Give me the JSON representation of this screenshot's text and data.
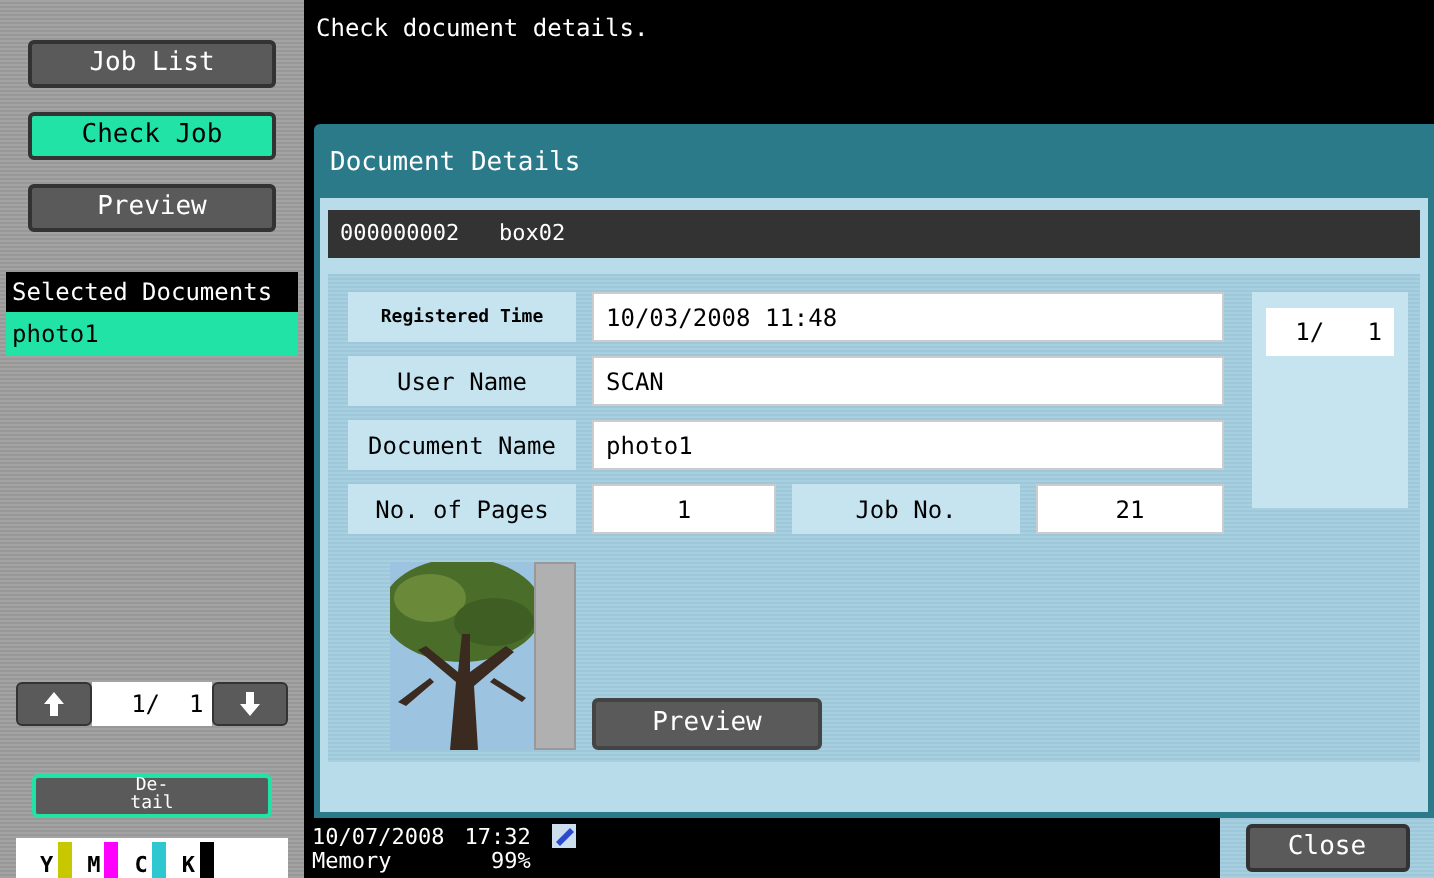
{
  "nav_buttons": [
    {
      "label": "Job List",
      "selected": false
    },
    {
      "label": "Check Job",
      "selected": true
    },
    {
      "label": "Preview",
      "selected": false
    }
  ],
  "selected_documents": {
    "title": "Selected Documents",
    "items": [
      {
        "label": "photo1",
        "selected": true
      }
    ]
  },
  "sidebar_pager": {
    "page": "1/  1"
  },
  "detail_button": {
    "label": "De-\ntail"
  },
  "toners": [
    {
      "label": "Y",
      "color": "#c8c800"
    },
    {
      "label": "M",
      "color": "#ff00ff"
    },
    {
      "label": "C",
      "color": "#30c8d0"
    },
    {
      "label": "K",
      "color": "#000000"
    }
  ],
  "message": "Check document details.",
  "dialog": {
    "title": "Document Details",
    "box_info": "000000002   box02",
    "fields": [
      {
        "label": "Registered Time",
        "value": "10/03/2008 11:48",
        "kind": "small"
      },
      {
        "label": "User Name",
        "value": "SCAN",
        "kind": "normal"
      },
      {
        "label": "Document Name",
        "value": "photo1",
        "kind": "normal"
      }
    ],
    "pages": {
      "label": "No. of Pages",
      "value": "1"
    },
    "job": {
      "label": "Job No.",
      "value": "21"
    },
    "page_counter": "1/   1",
    "preview_button": "Preview"
  },
  "status_bar": {
    "date": "10/07/2008",
    "time": "17:32",
    "memory_label": "Memory",
    "memory_value": "99%"
  },
  "close_button": "Close"
}
